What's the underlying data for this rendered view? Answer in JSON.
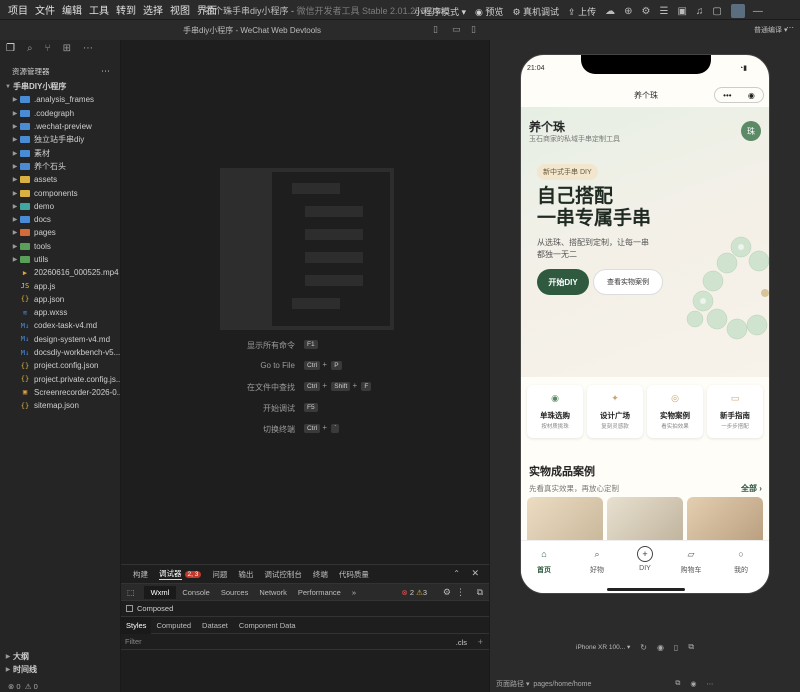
{
  "menubar": {
    "items": [
      "项目",
      "文件",
      "编辑",
      "工具",
      "转到",
      "选择",
      "视图",
      "界面",
      "..."
    ],
    "title": "养个珠手串diy小程序",
    "subtitle": "微信开发者工具 Stable 2.01.2510290",
    "mode": "小程序模式",
    "preview": "预览",
    "device_debug": "真机调试",
    "upload": "上传"
  },
  "bar2": {
    "title": "手串diy小程序 - WeChat Web Devtools",
    "compile_mode": "普通编译"
  },
  "explorer": {
    "header": "资源管理器",
    "root": "手串DIY小程序",
    "items": [
      {
        "name": ".analysis_frames",
        "type": "folder",
        "color": "#4a8bd6"
      },
      {
        "name": ".codegraph",
        "type": "folder",
        "color": "#4a8bd6"
      },
      {
        "name": ".wechat-preview",
        "type": "folder",
        "color": "#4a8bd6"
      },
      {
        "name": "独立站手串diy",
        "type": "folder",
        "color": "#4a8bd6"
      },
      {
        "name": "素材",
        "type": "folder",
        "color": "#4a8bd6"
      },
      {
        "name": "养个石头",
        "type": "folder",
        "color": "#4a8bd6"
      },
      {
        "name": "assets",
        "type": "folder",
        "color": "#d9b041"
      },
      {
        "name": "components",
        "type": "folder",
        "color": "#d9b041"
      },
      {
        "name": "demo",
        "type": "folder",
        "color": "#3fa7a0"
      },
      {
        "name": "docs",
        "type": "folder",
        "color": "#4a8bd6"
      },
      {
        "name": "pages",
        "type": "folder",
        "color": "#d46a3a"
      },
      {
        "name": "tools",
        "type": "folder",
        "color": "#5a9e5a"
      },
      {
        "name": "utils",
        "type": "folder",
        "color": "#5a9e5a"
      },
      {
        "name": "20260616_000525.mp4",
        "type": "file",
        "icon": "▶",
        "color": "#d9a441"
      },
      {
        "name": "app.js",
        "type": "file",
        "icon": "JS",
        "color": "#e8c84a"
      },
      {
        "name": "app.json",
        "type": "file",
        "icon": "{}",
        "color": "#d9b041"
      },
      {
        "name": "app.wxss",
        "type": "file",
        "icon": "≋",
        "color": "#4a8bd6"
      },
      {
        "name": "codex-task-v4.md",
        "type": "file",
        "icon": "M↓",
        "color": "#4a8bd6"
      },
      {
        "name": "design-system-v4.md",
        "type": "file",
        "icon": "M↓",
        "color": "#4a8bd6"
      },
      {
        "name": "docsdiy-workbench-v5...",
        "type": "file",
        "icon": "M↓",
        "color": "#4a8bd6"
      },
      {
        "name": "project.config.json",
        "type": "file",
        "icon": "{}",
        "color": "#d9b041"
      },
      {
        "name": "project.private.config.js...",
        "type": "file",
        "icon": "{}",
        "color": "#d9b041"
      },
      {
        "name": "Screenrecorder-2026-0...",
        "type": "file",
        "icon": "▣",
        "color": "#d9a441"
      },
      {
        "name": "sitemap.json",
        "type": "file",
        "icon": "{}",
        "color": "#d9b041"
      }
    ],
    "outline": "大纲",
    "timeline": "时间线",
    "status_errors": "0",
    "status_warnings": "0"
  },
  "editor": {
    "commands": [
      {
        "label": "显示所有命令",
        "keys": [
          "F1"
        ]
      },
      {
        "label": "Go to File",
        "keys": [
          "Ctrl",
          "+",
          "P"
        ]
      },
      {
        "label": "在文件中查找",
        "keys": [
          "Ctrl",
          "+",
          "Shift",
          "+",
          "F"
        ]
      },
      {
        "label": "开始调试",
        "keys": [
          "F5"
        ]
      },
      {
        "label": "切换终端",
        "keys": [
          "Ctrl",
          "+",
          "`"
        ]
      }
    ]
  },
  "panel": {
    "tabs": [
      "构建",
      "调试器",
      "问题",
      "输出",
      "调试控制台",
      "终端",
      "代码质量"
    ],
    "debugger_badge": "2, 3",
    "devtabs": [
      "Wxml",
      "Console",
      "Sources",
      "Network",
      "Performance"
    ],
    "errors": "2",
    "warnings": "3",
    "composed": "Composed",
    "styletabs": [
      "Styles",
      "Computed",
      "Dataset",
      "Component Data"
    ],
    "filter": "Filter",
    "cls": ".cls"
  },
  "phone": {
    "time": "21:04",
    "nav_title": "养个珠",
    "brand": "养个珠",
    "brand_sub": "玉石商家的私域手串定制工具",
    "avatar": "珠",
    "hero_tag": "新中式手串 DIY",
    "hero_title_1": "自己搭配",
    "hero_title_2": "一串专属手串",
    "hero_desc": "从选珠、搭配到定制，让每一串都独一无二",
    "btn_primary": "开始DIY",
    "btn_secondary": "查看实物案例",
    "cards": [
      {
        "title": "单珠选购",
        "sub": "按材质挑珠"
      },
      {
        "title": "设计广场",
        "sub": "复刻灵感款"
      },
      {
        "title": "实物案例",
        "sub": "看实拍效果"
      },
      {
        "title": "新手指南",
        "sub": "一步步搭配"
      }
    ],
    "section_title": "实物成品案例",
    "section_sub": "先看真实效果，再放心定制",
    "section_more": "全部 ›",
    "tabs": [
      "首页",
      "好物",
      "DIY",
      "购物车",
      "我的"
    ]
  },
  "sim_bottom": {
    "device": "iPhone XR 100...",
    "path_label": "页面路径",
    "path": "pages/home/home"
  },
  "colors": {
    "accent_green": "#2f5a40",
    "debug_badge": "#c0392b"
  }
}
